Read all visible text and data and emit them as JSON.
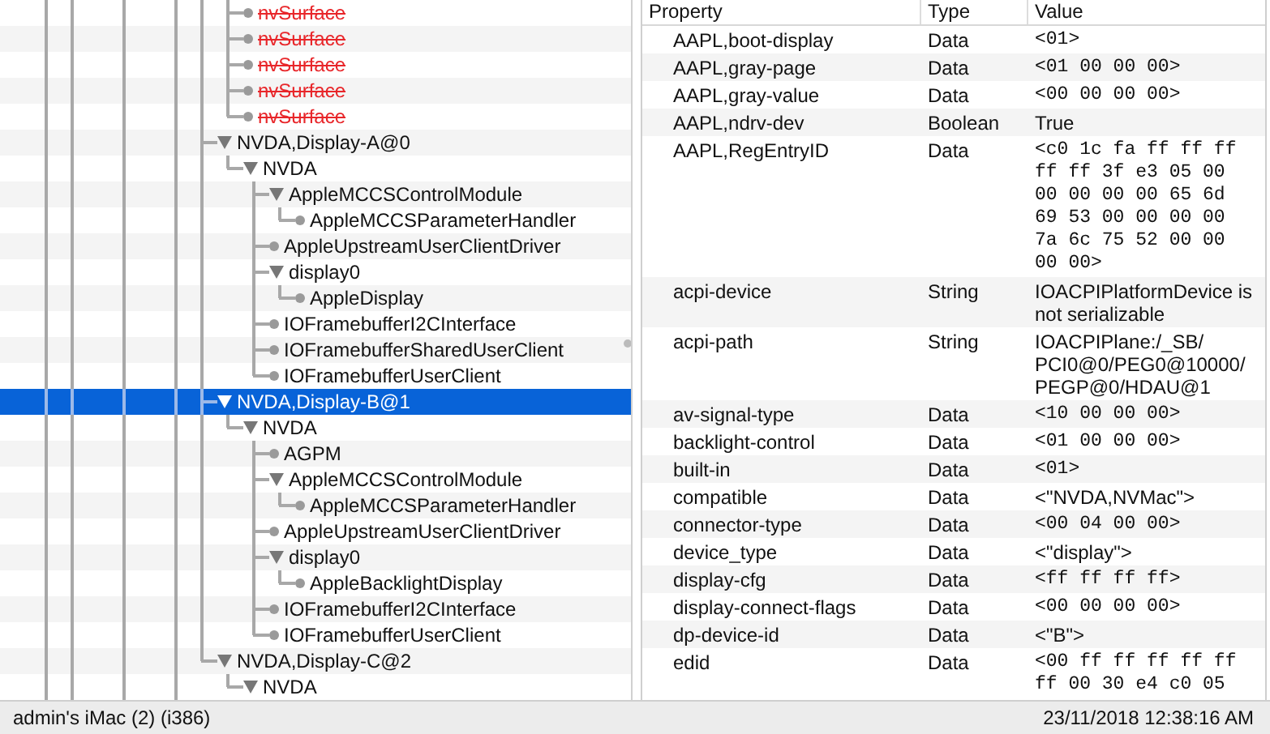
{
  "tree": [
    {
      "children": [
        {
          "label": "nvSurface",
          "terminated": true,
          "selected": false
        },
        {
          "label": "nvSurface",
          "terminated": true,
          "selected": false
        },
        {
          "label": "nvSurface",
          "terminated": true,
          "selected": false
        },
        {
          "label": "nvSurface",
          "terminated": true,
          "selected": false
        },
        {
          "label": "nvSurface",
          "terminated": true,
          "selected": false
        }
      ]
    },
    {
      "label": "NVDA,Display-A@0",
      "expanded": true,
      "selected": false,
      "children": [
        {
          "label": "NVDA",
          "expanded": true,
          "selected": false,
          "children": [
            {
              "label": "AppleMCCSControlModule",
              "expanded": true,
              "selected": false,
              "children": [
                {
                  "label": "AppleMCCSParameterHandler",
                  "selected": false
                }
              ]
            },
            {
              "label": "AppleUpstreamUserClientDriver",
              "selected": false
            },
            {
              "label": "display0",
              "expanded": true,
              "selected": false,
              "children": [
                {
                  "label": "AppleDisplay",
                  "selected": false
                }
              ]
            },
            {
              "label": "IOFramebufferI2CInterface",
              "selected": false
            },
            {
              "label": "IOFramebufferSharedUserClient",
              "selected": false
            },
            {
              "label": "IOFramebufferUserClient",
              "selected": false
            }
          ]
        }
      ]
    },
    {
      "label": "NVDA,Display-B@1",
      "expanded": true,
      "selected": true,
      "children": [
        {
          "label": "NVDA",
          "expanded": true,
          "selected": false,
          "children": [
            {
              "label": "AGPM",
              "selected": false
            },
            {
              "label": "AppleMCCSControlModule",
              "expanded": true,
              "selected": false,
              "children": [
                {
                  "label": "AppleMCCSParameterHandler",
                  "selected": false
                }
              ]
            },
            {
              "label": "AppleUpstreamUserClientDriver",
              "selected": false
            },
            {
              "label": "display0",
              "expanded": true,
              "selected": false,
              "children": [
                {
                  "label": "AppleBacklightDisplay",
                  "selected": false
                }
              ]
            },
            {
              "label": "IOFramebufferI2CInterface",
              "selected": false
            },
            {
              "label": "IOFramebufferUserClient",
              "selected": false
            }
          ]
        }
      ]
    },
    {
      "label": "NVDA,Display-C@2",
      "expanded": true,
      "selected": false,
      "children": [
        {
          "label": "NVDA",
          "expanded": true,
          "selected": false
        }
      ]
    }
  ],
  "properties": {
    "columns": [
      "Property",
      "Type",
      "Value"
    ],
    "rows": [
      {
        "property": "AAPL,boot-display",
        "type": "Data",
        "value": "<01>",
        "kind": "hex"
      },
      {
        "property": "AAPL,gray-page",
        "type": "Data",
        "value": "<01 00 00 00>",
        "kind": "hex"
      },
      {
        "property": "AAPL,gray-value",
        "type": "Data",
        "value": "<00 00 00 00>",
        "kind": "hex"
      },
      {
        "property": "AAPL,ndrv-dev",
        "type": "Boolean",
        "value": "True",
        "kind": "text"
      },
      {
        "property": "AAPL,RegEntryID",
        "type": "Data",
        "value": "<c0 1c fa ff ff ff ff ff 3f e3 05 00 00 00 00 00 65 6d 69 53 00 00 00 00 7a 6c 75 52 00 00 00 00>",
        "kind": "hex"
      },
      {
        "property": "acpi-device",
        "type": "String",
        "value": "IOACPIPlatformDevice is not serializable",
        "kind": "text"
      },
      {
        "property": "acpi-path",
        "type": "String",
        "value": "IOACPIPlane:/_SB/PCI0@0/PEG0@10000/PEGP@0/HDAU@1",
        "kind": "path"
      },
      {
        "property": "av-signal-type",
        "type": "Data",
        "value": "<10 00 00 00>",
        "kind": "hex"
      },
      {
        "property": "backlight-control",
        "type": "Data",
        "value": "<01 00 00 00>",
        "kind": "hex"
      },
      {
        "property": "built-in",
        "type": "Data",
        "value": "<01>",
        "kind": "hex"
      },
      {
        "property": "compatible",
        "type": "Data",
        "value": "<\"NVDA,NVMac\">",
        "kind": "text"
      },
      {
        "property": "connector-type",
        "type": "Data",
        "value": "<00 04 00 00>",
        "kind": "hex"
      },
      {
        "property": "device_type",
        "type": "Data",
        "value": "<\"display\">",
        "kind": "text"
      },
      {
        "property": "display-cfg",
        "type": "Data",
        "value": "<ff ff ff ff>",
        "kind": "hex"
      },
      {
        "property": "display-connect-flags",
        "type": "Data",
        "value": "<00 00 00 00>",
        "kind": "hex"
      },
      {
        "property": "dp-device-id",
        "type": "Data",
        "value": "<\"B\">",
        "kind": "text"
      },
      {
        "property": "edid",
        "type": "Data",
        "value": "<00 ff ff ff ff ff ff 00 30 e4 c0 05",
        "kind": "hex"
      }
    ]
  },
  "status_bar": {
    "left": "admin's iMac (2) (i386)",
    "right": "23/11/2018 12:38:16 AM"
  }
}
